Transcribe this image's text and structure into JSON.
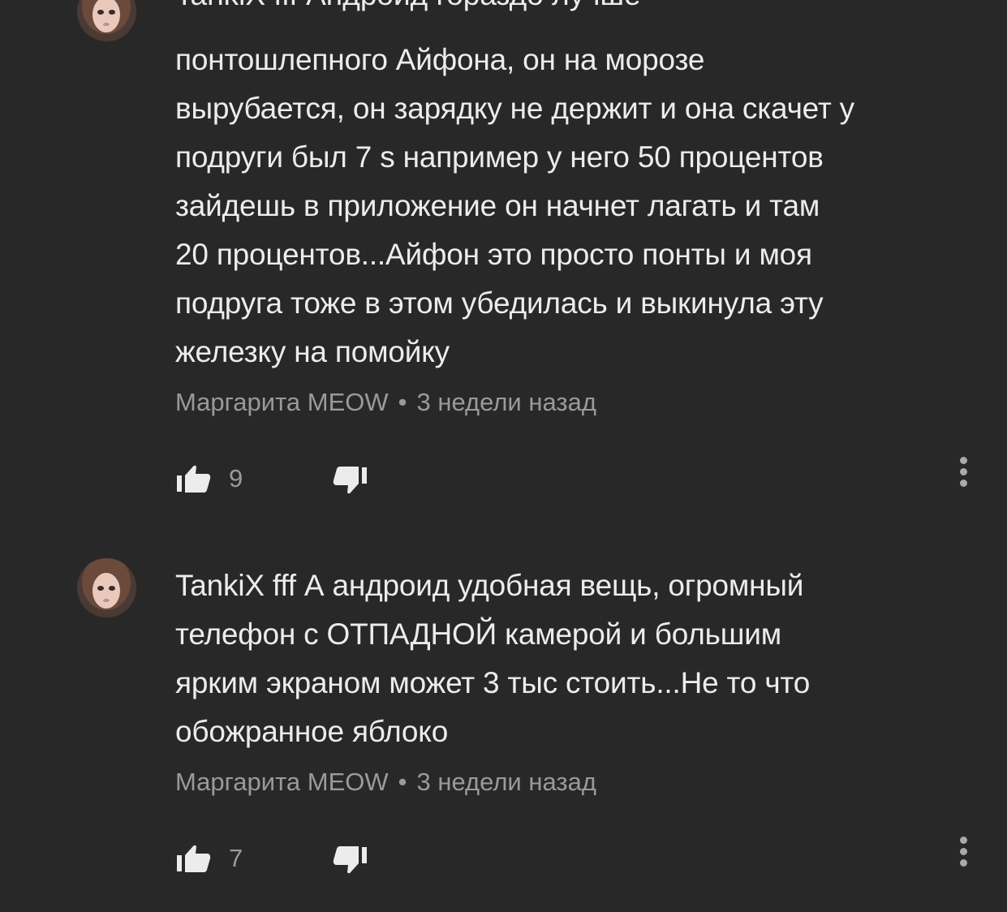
{
  "comments": [
    {
      "partial_line": "TankiX fff Андроид гораздо лучше",
      "lines": [
        "понтошлепного Айфона, он на морозе",
        "вырубается, он зарядку не держит и она скачет у",
        "подруги был 7 s например у него 50 процентов",
        "зайдешь в приложение он начнет лагать и там",
        "20 процентов...Айфон это просто понты и моя",
        "подруга тоже в этом убедилась и выкинула эту",
        "железку на помойку"
      ],
      "author": "Маргарита MEOW",
      "separator": "•",
      "time": "3 недели назад",
      "likes": "9",
      "like_icon": "thumbs-up-icon",
      "dislike_icon": "thumbs-down-icon",
      "more_icon": "more-vertical-icon"
    },
    {
      "lines": [
        "TankiX fff А андроид удобная вещь, огромный",
        "телефон с ОТПАДНОЙ камерой и большим",
        "ярким экраном может 3 тыс стоить...Не то что",
        "обожранное яблоко"
      ],
      "author": "Маргарита MEOW",
      "separator": "•",
      "time": "3 недели назад",
      "likes": "7",
      "like_icon": "thumbs-up-icon",
      "dislike_icon": "thumbs-down-icon",
      "more_icon": "more-vertical-icon"
    }
  ],
  "colors": {
    "background": "#282828",
    "text": "#ececec",
    "meta": "#9a9a9a",
    "icon": "#ececec"
  }
}
